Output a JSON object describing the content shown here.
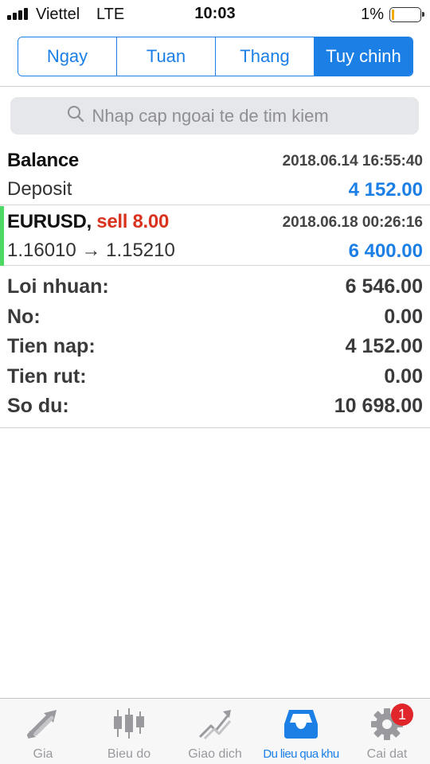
{
  "status_bar": {
    "carrier": "Viettel",
    "network": "LTE",
    "time": "10:03",
    "battery": "1%",
    "battery_level": 0.01
  },
  "period_tabs": {
    "items": [
      "Ngay",
      "Tuan",
      "Thang",
      "Tuy chinh"
    ],
    "selected": "Tuy chinh"
  },
  "search": {
    "placeholder": "Nhap cap ngoai te de tim kiem"
  },
  "history": {
    "balance_entry": {
      "title": "Balance",
      "subtitle": "Deposit",
      "time": "2018.06.14 16:55:40",
      "amount": "4 152.00"
    },
    "trade_entry": {
      "symbol": "EURUSD,",
      "action": "sell 8.00",
      "prices": "1.16010 → 1.15210",
      "time": "2018.06.18 00:26:16",
      "amount": "6 400.00"
    }
  },
  "summary": [
    {
      "label": "Loi nhuan:",
      "value": "6 546.00"
    },
    {
      "label": "No:",
      "value": "0.00"
    },
    {
      "label": "Tien nap:",
      "value": "4 152.00"
    },
    {
      "label": "Tien rut:",
      "value": "0.00"
    },
    {
      "label": "So du:",
      "value": "10 698.00"
    }
  ],
  "tab_bar": {
    "items": [
      {
        "label": "Gia",
        "icon": "quotes-arrows-icon"
      },
      {
        "label": "Bieu do",
        "icon": "candlestick-chart-icon"
      },
      {
        "label": "Giao dich",
        "icon": "trade-chart-icon"
      },
      {
        "label": "Du lieu qua khu",
        "icon": "inbox-tray-icon"
      },
      {
        "label": "Cai dat",
        "icon": "gear-icon"
      }
    ],
    "active": "Du lieu qua khu",
    "settings_badge": "1"
  },
  "colors": {
    "accent": "#1b7fe6",
    "sell": "#d9331f",
    "trade_marker": "#4cd964",
    "badge": "#e0262a"
  }
}
